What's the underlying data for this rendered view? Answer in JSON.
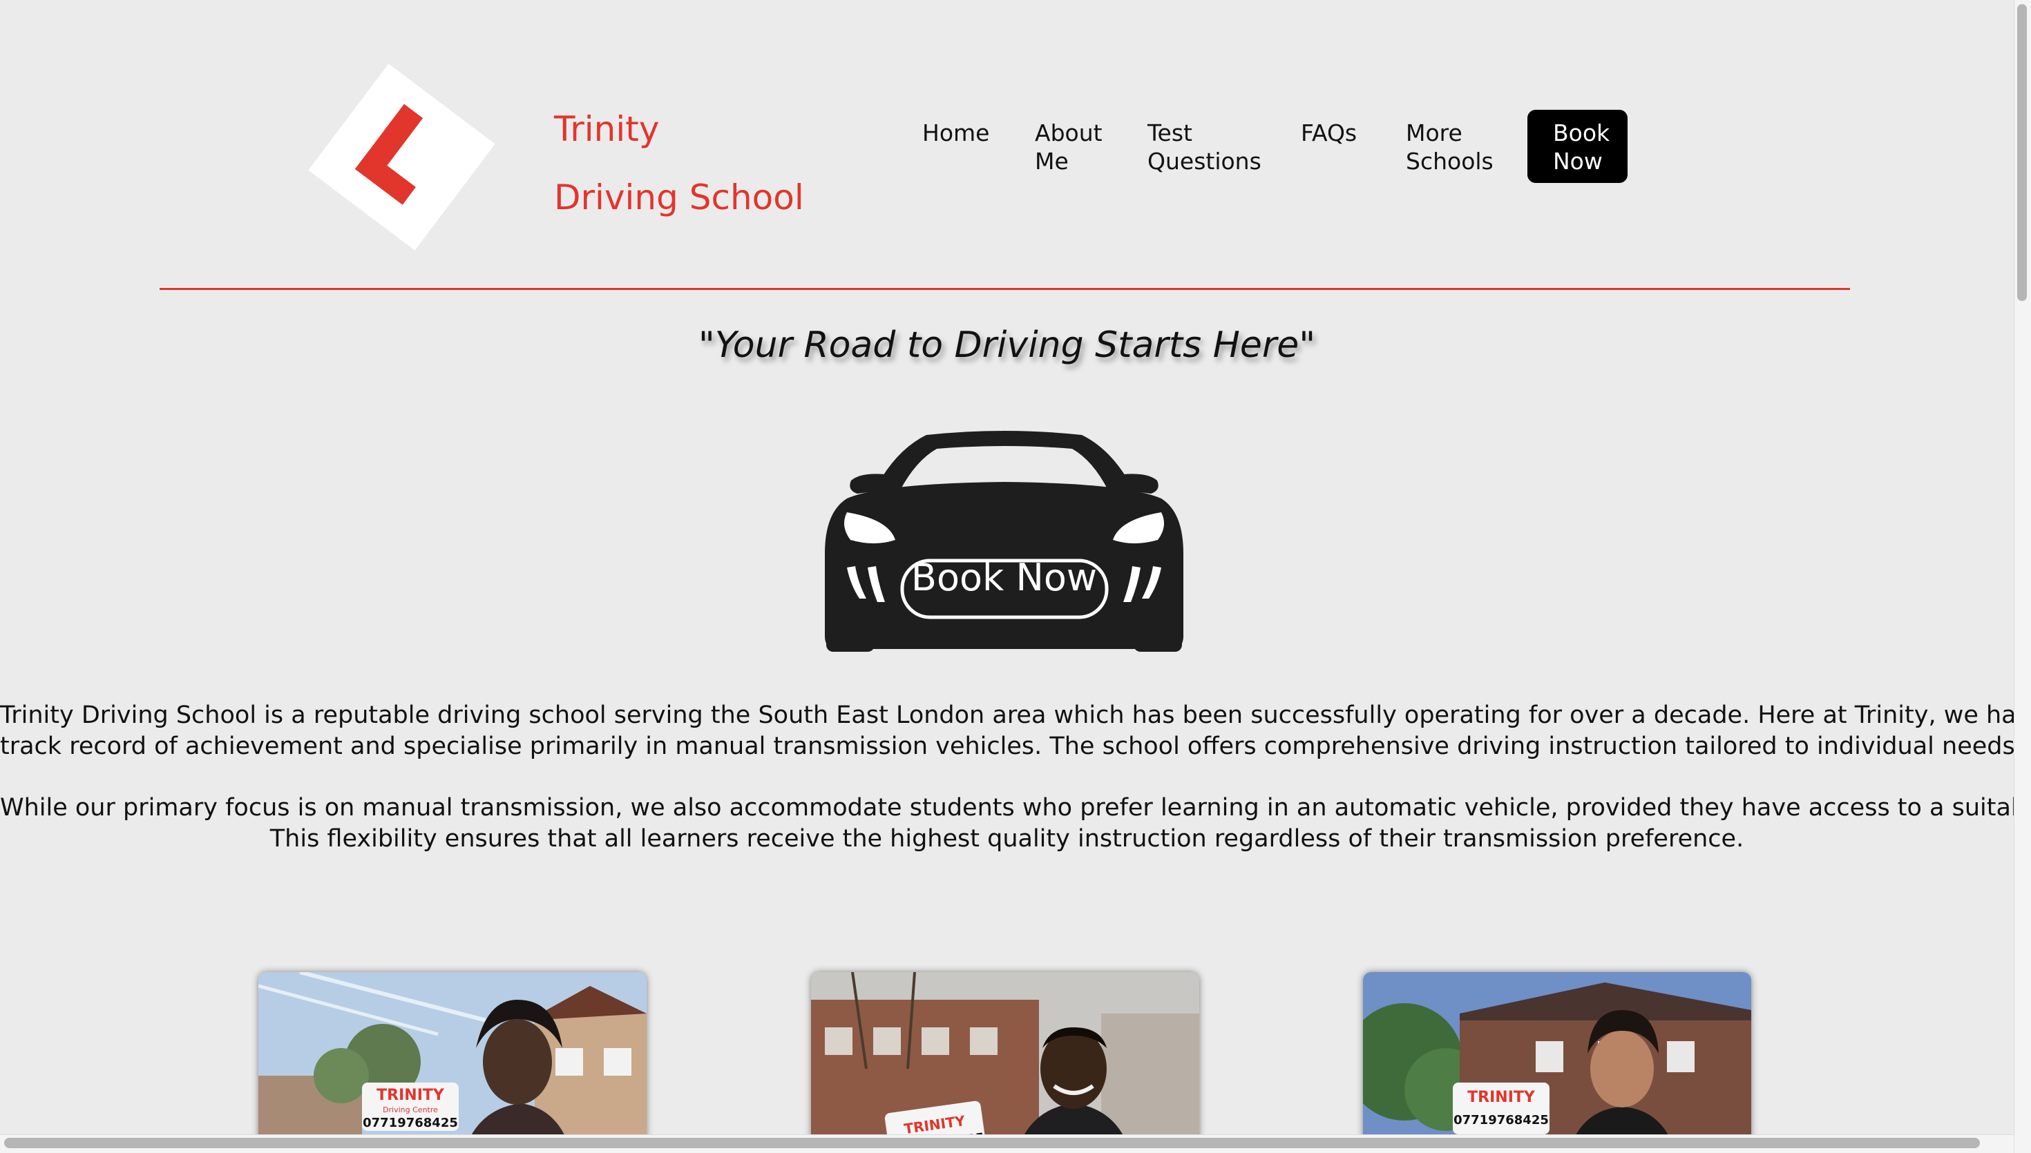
{
  "brand": {
    "line1": "Trinity",
    "line2": "Driving School",
    "color": "#e2352b"
  },
  "nav": {
    "home": "Home",
    "about_line1": "About",
    "about_line2": "Me",
    "test_line1": "Test",
    "test_line2": "Questions",
    "faqs": "FAQs",
    "more_line1": "More",
    "more_line2": "Schools",
    "book_line1": "Book",
    "book_line2": "Now"
  },
  "hero": {
    "tagline": "\"Your Road to Driving Starts Here\"",
    "cta_label": "Book Now"
  },
  "intro": {
    "p1_line1": "Trinity Driving School is a reputable driving school serving the South East London area which has been successfully operating for over a decade. Here at Trinity, we have a strong",
    "p1_line2": "track record of achievement and specialise primarily in manual transmission vehicles. The school offers comprehensive driving instruction tailored to individual needs.",
    "p2_line1": "While our primary focus is on manual transmission, we also accommodate students who prefer learning in an automatic vehicle, provided they have access to a suitable vehicle.",
    "p2_line2": "This flexibility ensures that all learners receive the highest quality instruction regardless of their transmission preference."
  },
  "gallery": {
    "roof_sign_title": "TRINITY",
    "roof_sign_sub": "Driving Centre",
    "roof_sign_phone": "07719768425"
  },
  "colors": {
    "accent": "#e2352b",
    "page_bg": "#ebebeb",
    "car": "#1e1e1e",
    "button": "#000000"
  },
  "icons": {
    "logo": "learner-l-plate-icon",
    "cta": "car-front-icon"
  }
}
